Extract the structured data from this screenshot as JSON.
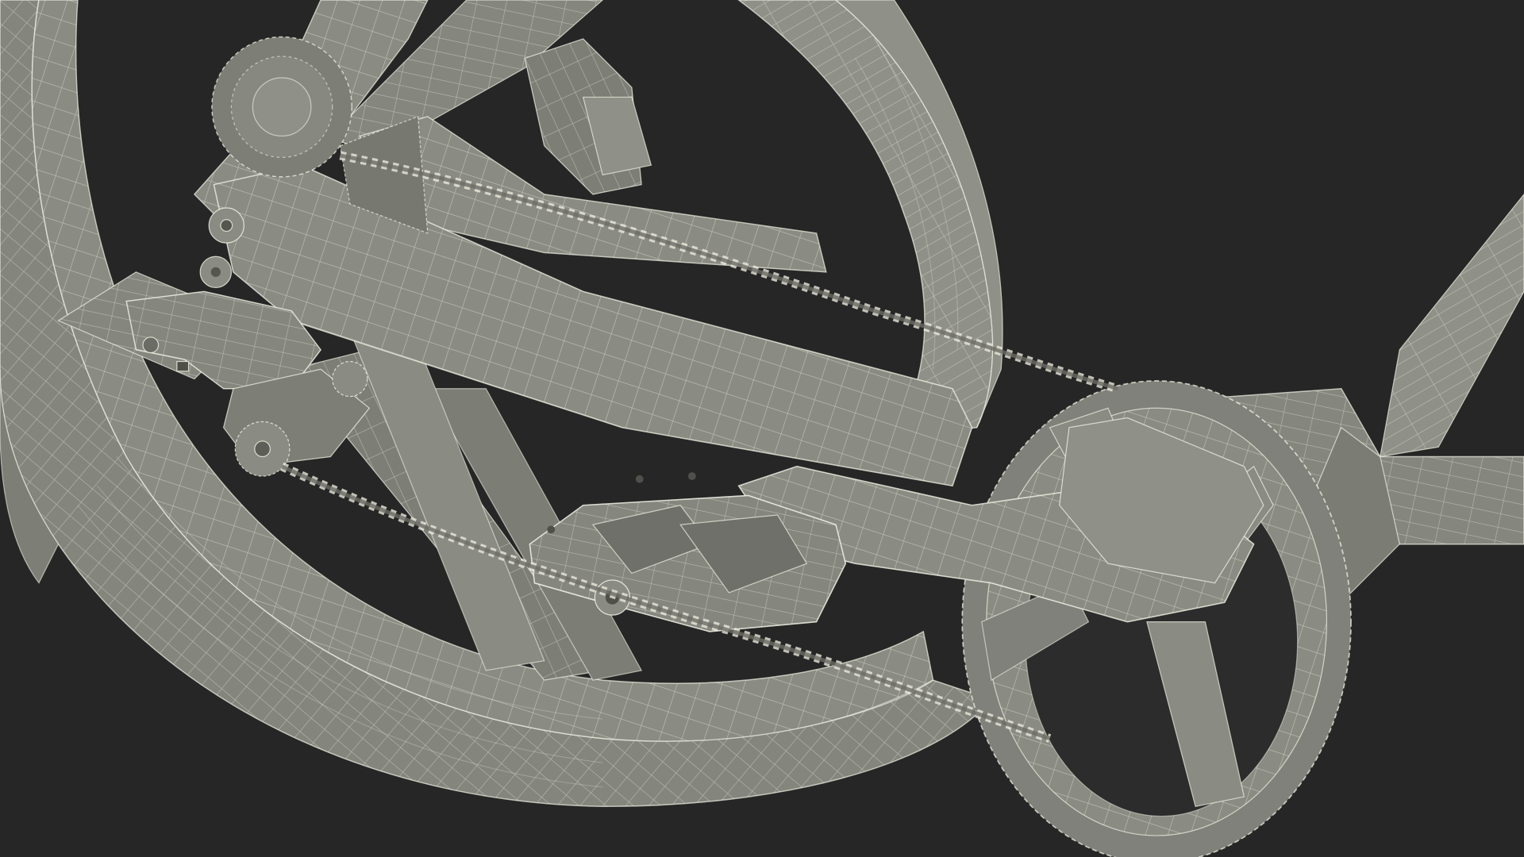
{
  "scene": {
    "subject": "bicycle-drivetrain-wireframe-render",
    "icon": "bicycle-drivetrain-icon",
    "colors": {
      "background": "#262626",
      "mesh_fill": "#8a8b82",
      "mesh_shadow": "#6e6f68",
      "mesh_highlight": "#a3a49a",
      "wire": "#e8e8dc"
    }
  }
}
